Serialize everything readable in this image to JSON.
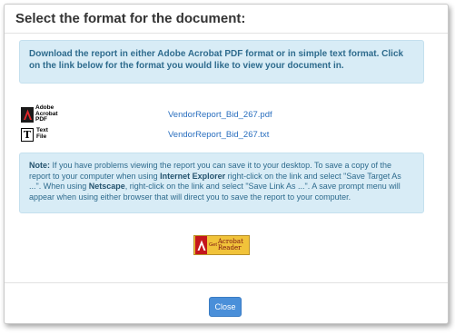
{
  "dialog": {
    "title": "Select the format for the document:"
  },
  "intro": {
    "text": "Download the report in either Adobe Acrobat PDF format or in simple text format.  Click on the link below for the format you would like to view your document in."
  },
  "downloads": [
    {
      "icon": "adobe-acrobat-pdf-icon",
      "icon_text": [
        "Adobe",
        "Acrobat",
        "PDF"
      ],
      "link": "VendorReport_Bid_267.pdf"
    },
    {
      "icon": "text-file-icon",
      "icon_letter": "T",
      "icon_text": [
        "Text",
        "File"
      ],
      "link": "VendorReport_Bid_267.txt"
    }
  ],
  "note": {
    "label": "Note:",
    "part1": " If you have problems viewing the report you can save it to your desktop.  To save a copy of the report to your computer when using ",
    "ie": "Internet Explorer",
    "part2": " right-click on the link and select \"Save Target As ...\".  When using ",
    "netscape": "Netscape",
    "part3": ", right-click on the link and select \"Save Link As ...\". A save prompt menu will appear when using either browser that will direct you to save the report to your computer."
  },
  "get_reader_badge": {
    "brand": "Adobe",
    "get": "Get",
    "product_line1": "Acrobat",
    "product_line2": "Reader"
  },
  "footer": {
    "close_label": "Close"
  },
  "colors": {
    "info_bg": "#d8ecf6",
    "info_text": "#2e6b8d",
    "link": "#2a6fbf",
    "button": "#4a8fd9"
  }
}
